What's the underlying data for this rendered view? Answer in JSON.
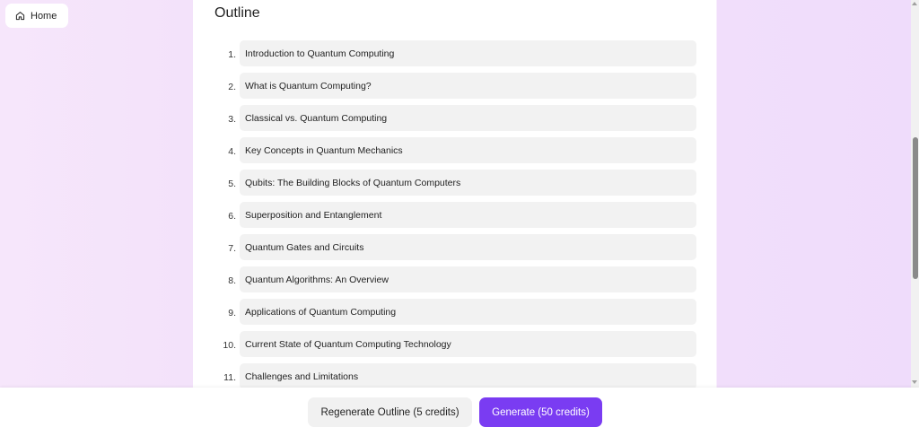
{
  "home": {
    "label": "Home",
    "icon": "home-icon"
  },
  "outline": {
    "title": "Outline",
    "items": [
      {
        "number": "1.",
        "text": "Introduction to Quantum Computing"
      },
      {
        "number": "2.",
        "text": "What is Quantum Computing?"
      },
      {
        "number": "3.",
        "text": "Classical vs. Quantum Computing"
      },
      {
        "number": "4.",
        "text": "Key Concepts in Quantum Mechanics"
      },
      {
        "number": "5.",
        "text": "Qubits: The Building Blocks of Quantum Computers"
      },
      {
        "number": "6.",
        "text": "Superposition and Entanglement"
      },
      {
        "number": "7.",
        "text": "Quantum Gates and Circuits"
      },
      {
        "number": "8.",
        "text": "Quantum Algorithms: An Overview"
      },
      {
        "number": "9.",
        "text": "Applications of Quantum Computing"
      },
      {
        "number": "10.",
        "text": "Current State of Quantum Computing Technology"
      },
      {
        "number": "11.",
        "text": "Challenges and Limitations"
      }
    ]
  },
  "footer": {
    "regenerate_label": "Regenerate Outline (5 credits)",
    "generate_label": "Generate (50 credits)"
  },
  "colors": {
    "accent": "#7a3cf2",
    "page_background": "#f3e2fa",
    "item_background": "#f2f2f2"
  }
}
